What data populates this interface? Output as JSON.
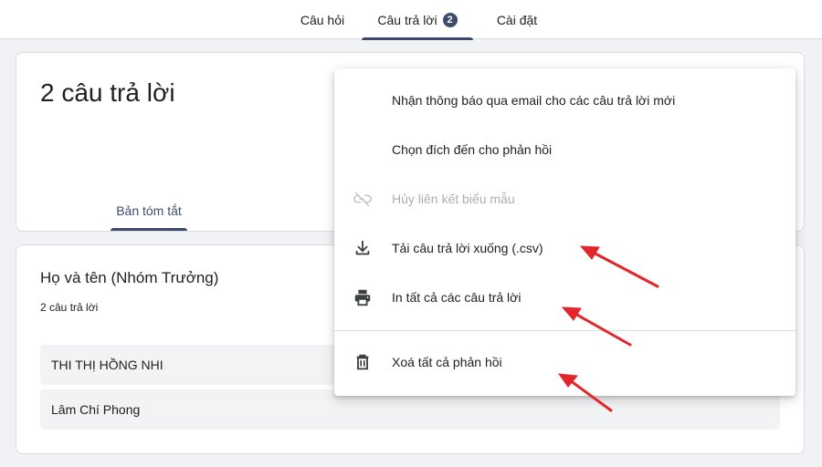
{
  "tabs": {
    "questions": "Câu hỏi",
    "responses": "Câu trả lời",
    "responses_count": "2",
    "settings": "Cài đặt"
  },
  "summary_card": {
    "title": "2 câu trả lời",
    "summary_tab": "Bản tóm tắt"
  },
  "question_card": {
    "title": "Họ và tên (Nhóm Trưởng)",
    "count": "2 câu trả lời",
    "answers": [
      "THI THỊ HỒNG NHI",
      "Lâm Chí Phong"
    ]
  },
  "menu": {
    "items": [
      {
        "label": "Nhận thông báo qua email cho các câu trả lời mới",
        "icon": "",
        "disabled": false
      },
      {
        "label": "Chọn đích đến cho phản hồi",
        "icon": "",
        "disabled": false
      },
      {
        "label": "Hủy liên kết biểu mẫu",
        "icon": "link-off-icon",
        "disabled": true
      },
      {
        "label": "Tải câu trả lời xuống (.csv)",
        "icon": "download-icon",
        "disabled": false
      },
      {
        "label": "In tất cả các câu trả lời",
        "icon": "printer-icon",
        "disabled": false
      },
      {
        "label": "Xoá tất cả phản hồi",
        "icon": "trash-icon",
        "disabled": false
      }
    ]
  },
  "colors": {
    "accent": "#3c4a6e",
    "annotation_arrow": "#e3262a",
    "background": "#f0f2f5"
  }
}
